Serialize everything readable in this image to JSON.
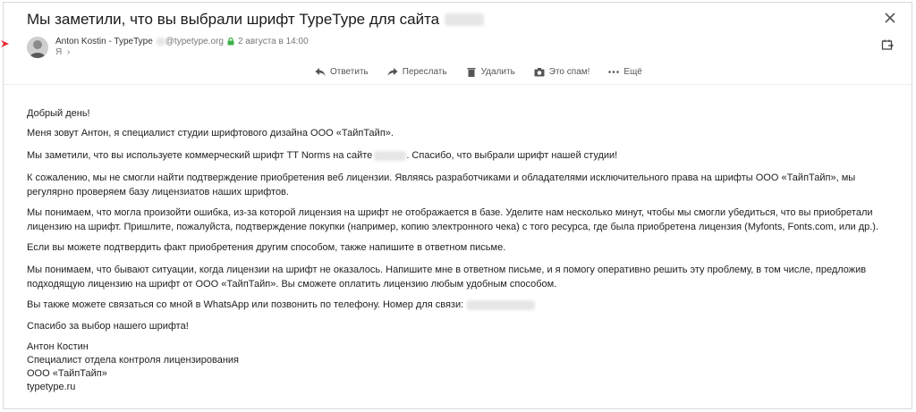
{
  "email": {
    "subject": "Мы заметили, что вы выбрали шрифт TypeType для сайта",
    "sender_name": "Anton Kostin - TypeType",
    "sender_email": "@typetype.org",
    "date": "2 августа в 14:00",
    "recipient": "Я",
    "recipient_chevron": "›"
  },
  "toolbar": {
    "reply": "Ответить",
    "forward": "Переслать",
    "delete": "Удалить",
    "spam": "Это спам!",
    "more": "Ещё"
  },
  "body": {
    "greeting": "Добрый день!",
    "p1": "Меня зовут Антон, я специалист студии шрифтового дизайна ООО «ТайпТайп».",
    "p2_before": "Мы заметили, что вы используете коммерческий шрифт TT Norms на сайте",
    "p2_after": ". Спасибо, что выбрали шрифт нашей студии!",
    "p3": "К сожалению, мы не смогли найти подтверждение приобретения веб лицензии. Являясь разработчиками и обладателями исключительного права на шрифты ООО «ТайпТайп», мы регулярно проверяем базу лицензиатов наших шрифтов.",
    "p4": "Мы понимаем, что могла произойти ошибка, из-за которой лицензия на шрифт не отображается в базе. Уделите нам несколько минут, чтобы мы смогли убедиться, что вы приобретали лицензию на шрифт. Пришлите, пожалуйста, подтверждение покупки (например, копию электронного чека) с того ресурса, где была приобретена лицензия (Myfonts, Fonts.com, или др.).",
    "p5": "Если вы можете подтвердить факт приобретения другим способом, также напишите в ответном письме.",
    "p6": "Мы понимаем, что бывают ситуации, когда лицензии на шрифт не оказалось. Напишите мне в ответном письме, и я помогу оперативно решить эту проблему, в том числе, предложив подходящую лицензию на шрифт от ООО «ТайпТайп». Вы сможете оплатить лицензию любым удобным способом.",
    "p7": "Вы также можете связаться со мной в WhatsApp или позвонить по телефону. Номер для связи:",
    "p8": "Спасибо за выбор нашего шрифта!",
    "sig_name": "Антон Костин",
    "sig_title": "Специалист отдела контроля лицензирования",
    "sig_company": "ООО «ТайпТайп»",
    "sig_site": "typetype.ru"
  },
  "colors": {
    "flag": "#e8262f",
    "secure_lock": "#3cb04a"
  }
}
